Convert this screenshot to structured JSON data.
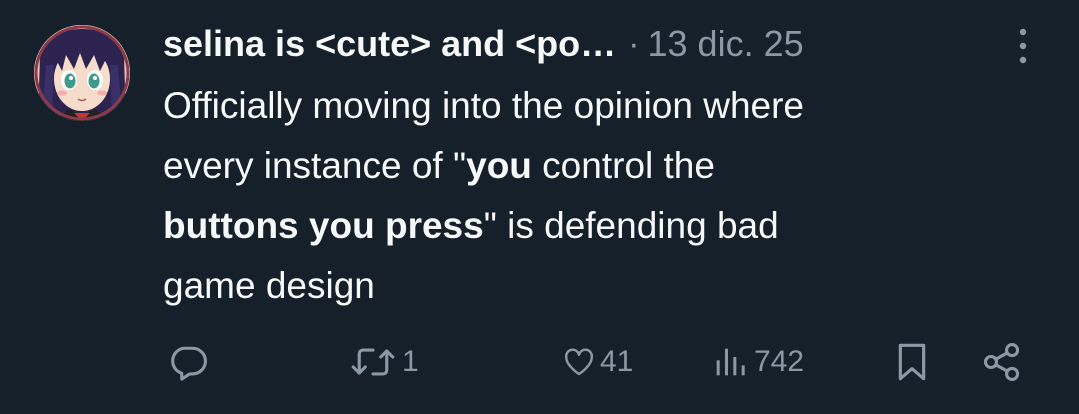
{
  "tweet": {
    "display_name": "selina is <cute> and <po…",
    "separator": "·",
    "timestamp": "13 dic. 25",
    "text": {
      "line1": "Officially moving into the opinion where",
      "line2_pre": "every instance of \"",
      "line2_bold": "you",
      "line2_post": " control the",
      "line3_bold": "buttons you press",
      "line3_post": "\" is defending bad",
      "line4": "game design"
    }
  },
  "actions": {
    "reply_icon": "reply-icon",
    "retweet_icon": "retweet-icon",
    "retweet_count": "1",
    "like_icon": "heart-icon",
    "like_count": "41",
    "views_icon": "views-chart-icon",
    "views_count": "742",
    "bookmark_icon": "bookmark-icon",
    "share_icon": "share-icon"
  },
  "more_icon": "vertical-ellipsis-icon",
  "colors": {
    "background": "#15202b",
    "text_primary": "#f7f9f9",
    "text_secondary": "#8b98a5"
  }
}
